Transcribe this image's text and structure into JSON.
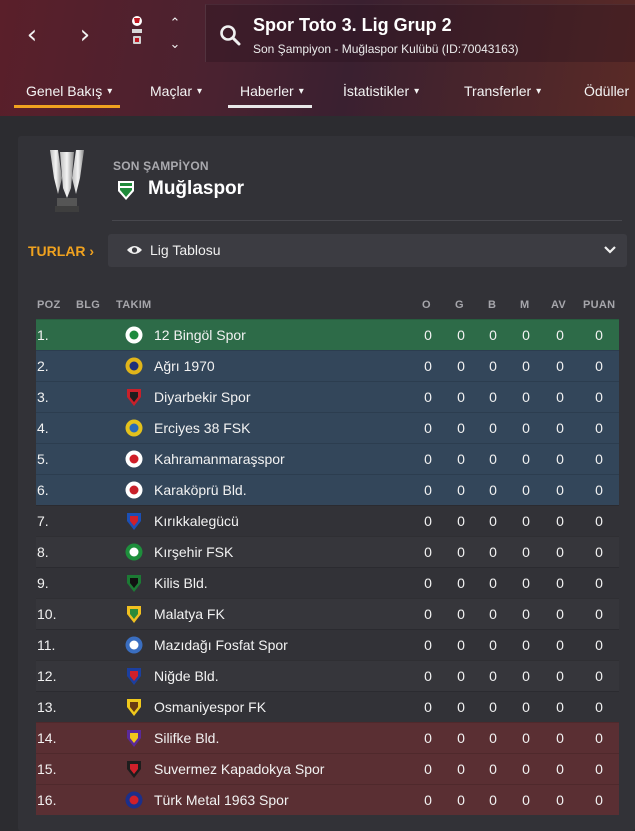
{
  "header": {
    "back_glyph": "‹",
    "forward_glyph": "›",
    "up_glyph": "⌃",
    "down_glyph": "⌄",
    "title": "Spor Toto 3. Lig Grup 2",
    "subtitle": "Son Şampiyon - Muğlaspor Kulübü (ID:70043163)",
    "tabs": [
      {
        "label": "Genel Bakış",
        "chevron": "▾",
        "active": true,
        "underline": "#f0a21f"
      },
      {
        "label": "Maçlar",
        "chevron": "▾"
      },
      {
        "label": "Haberler",
        "chevron": "▾",
        "underline": "#e8e8e8"
      },
      {
        "label": "İstatistikler",
        "chevron": "▾"
      },
      {
        "label": "Transferler",
        "chevron": "▾"
      },
      {
        "label": "Ödüller"
      }
    ]
  },
  "champion": {
    "label": "SON ŞAMPİYON",
    "name": "Muğlaspor"
  },
  "controls": {
    "rounds_label": "TURLAR ›",
    "view_label": "Lig Tablosu"
  },
  "table": {
    "columns": {
      "pos": "POZ",
      "blg": "BLG",
      "team": "TAKIM",
      "o": "O",
      "g": "G",
      "b": "B",
      "m": "M",
      "av": "AV",
      "puan": "PUAN"
    },
    "rows": [
      {
        "pos": "1.",
        "team": "12 Bingöl Spor",
        "o": "0",
        "g": "0",
        "b": "0",
        "m": "0",
        "av": "0",
        "puan": "0",
        "zone": "champion",
        "badge": "bingol-badge-icon"
      },
      {
        "pos": "2.",
        "team": "Ağrı 1970",
        "o": "0",
        "g": "0",
        "b": "0",
        "m": "0",
        "av": "0",
        "puan": "0",
        "zone": "playoff",
        "badge": "agri-badge-icon"
      },
      {
        "pos": "3.",
        "team": "Diyarbekir Spor",
        "o": "0",
        "g": "0",
        "b": "0",
        "m": "0",
        "av": "0",
        "puan": "0",
        "zone": "playoff",
        "badge": "diyarbekir-badge-icon"
      },
      {
        "pos": "4.",
        "team": "Erciyes 38 FSK",
        "o": "0",
        "g": "0",
        "b": "0",
        "m": "0",
        "av": "0",
        "puan": "0",
        "zone": "playoff",
        "badge": "erciyes-badge-icon"
      },
      {
        "pos": "5.",
        "team": "Kahramanmaraşspor",
        "o": "0",
        "g": "0",
        "b": "0",
        "m": "0",
        "av": "0",
        "puan": "0",
        "zone": "playoff",
        "badge": "kahramanmaras-badge-icon"
      },
      {
        "pos": "6.",
        "team": "Karaköprü Bld.",
        "o": "0",
        "g": "0",
        "b": "0",
        "m": "0",
        "av": "0",
        "puan": "0",
        "zone": "playoff",
        "badge": "karakopru-badge-icon"
      },
      {
        "pos": "7.",
        "team": "Kırıkkalegücü",
        "o": "0",
        "g": "0",
        "b": "0",
        "m": "0",
        "av": "0",
        "puan": "0",
        "zone": "none",
        "badge": "kirikkale-badge-icon"
      },
      {
        "pos": "8.",
        "team": "Kırşehir FSK",
        "o": "0",
        "g": "0",
        "b": "0",
        "m": "0",
        "av": "0",
        "puan": "0",
        "zone": "none",
        "badge": "kirsehir-badge-icon"
      },
      {
        "pos": "9.",
        "team": "Kilis Bld.",
        "o": "0",
        "g": "0",
        "b": "0",
        "m": "0",
        "av": "0",
        "puan": "0",
        "zone": "none",
        "badge": "kilis-badge-icon"
      },
      {
        "pos": "10.",
        "team": "Malatya FK",
        "o": "0",
        "g": "0",
        "b": "0",
        "m": "0",
        "av": "0",
        "puan": "0",
        "zone": "none",
        "badge": "malatya-badge-icon"
      },
      {
        "pos": "11.",
        "team": "Mazıdağı Fosfat Spor",
        "o": "0",
        "g": "0",
        "b": "0",
        "m": "0",
        "av": "0",
        "puan": "0",
        "zone": "none",
        "badge": "mazidagi-badge-icon"
      },
      {
        "pos": "12.",
        "team": "Niğde Bld.",
        "o": "0",
        "g": "0",
        "b": "0",
        "m": "0",
        "av": "0",
        "puan": "0",
        "zone": "none",
        "badge": "nigde-badge-icon"
      },
      {
        "pos": "13.",
        "team": "Osmaniyespor FK",
        "o": "0",
        "g": "0",
        "b": "0",
        "m": "0",
        "av": "0",
        "puan": "0",
        "zone": "none",
        "badge": "osmaniye-badge-icon"
      },
      {
        "pos": "14.",
        "team": "Silifke Bld.",
        "o": "0",
        "g": "0",
        "b": "0",
        "m": "0",
        "av": "0",
        "puan": "0",
        "zone": "relegation",
        "badge": "silifke-badge-icon"
      },
      {
        "pos": "15.",
        "team": "Suvermez Kapadokya Spor",
        "o": "0",
        "g": "0",
        "b": "0",
        "m": "0",
        "av": "0",
        "puan": "0",
        "zone": "relegation",
        "badge": "suvermez-badge-icon"
      },
      {
        "pos": "16.",
        "team": "Türk Metal 1963 Spor",
        "o": "0",
        "g": "0",
        "b": "0",
        "m": "0",
        "av": "0",
        "puan": "0",
        "zone": "relegation",
        "badge": "turkmetal-badge-icon"
      }
    ]
  },
  "colors": {
    "accent": "#f0a21f",
    "zone_champion": "#2d6b48",
    "zone_playoff": "#33465a",
    "zone_relegation": "#5a2f33",
    "zone_none_a": "#323237",
    "zone_none_b": "#36363b"
  }
}
